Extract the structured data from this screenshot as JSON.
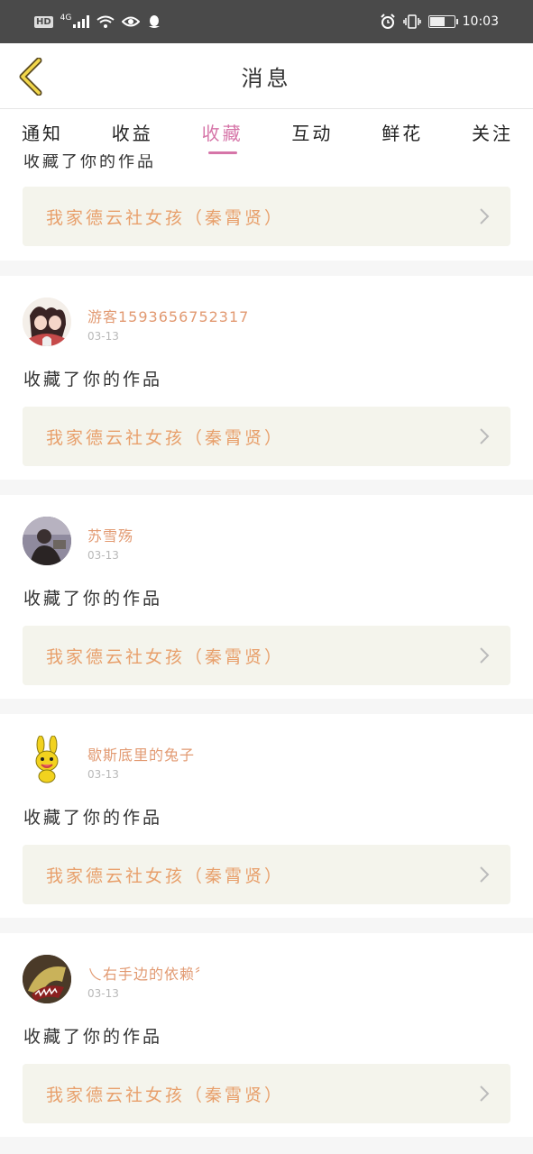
{
  "status_bar": {
    "left_badges": [
      "HD",
      "4G"
    ],
    "time": "10:03"
  },
  "header": {
    "title": "消息"
  },
  "tabs": [
    {
      "label": "通知",
      "active": false
    },
    {
      "label": "收益",
      "active": false
    },
    {
      "label": "收藏",
      "active": true
    },
    {
      "label": "互动",
      "active": false
    },
    {
      "label": "鲜花",
      "active": false
    },
    {
      "label": "关注",
      "active": false
    }
  ],
  "colors": {
    "accent": "#d675a8",
    "username": "#e29a72",
    "work_title": "#e8a06c",
    "work_box_bg": "#f4f4ec"
  },
  "partial_item": {
    "action": "收藏了你的作品",
    "work_title": "我家德云社女孩（秦霄贤）"
  },
  "messages": [
    {
      "avatar_icon": "anime-couple-avatar",
      "username": "游客1593656752317",
      "date": "03-13",
      "action": "收藏了你的作品",
      "work_title": "我家德云社女孩（秦霄贤）"
    },
    {
      "avatar_icon": "person-photo-avatar",
      "username": "苏雪殇",
      "date": "03-13",
      "action": "收藏了你的作品",
      "work_title": "我家德云社女孩（秦霄贤）"
    },
    {
      "avatar_icon": "yellow-bunny-avatar",
      "username": "歇斯底里的兔子",
      "date": "03-13",
      "action": "收藏了你的作品",
      "work_title": "我家德云社女孩（秦霄贤）"
    },
    {
      "avatar_icon": "shark-avatar",
      "username": "乀右手边的依赖〞",
      "date": "03-13",
      "action": "收藏了你的作品",
      "work_title": "我家德云社女孩（秦霄贤）"
    }
  ]
}
